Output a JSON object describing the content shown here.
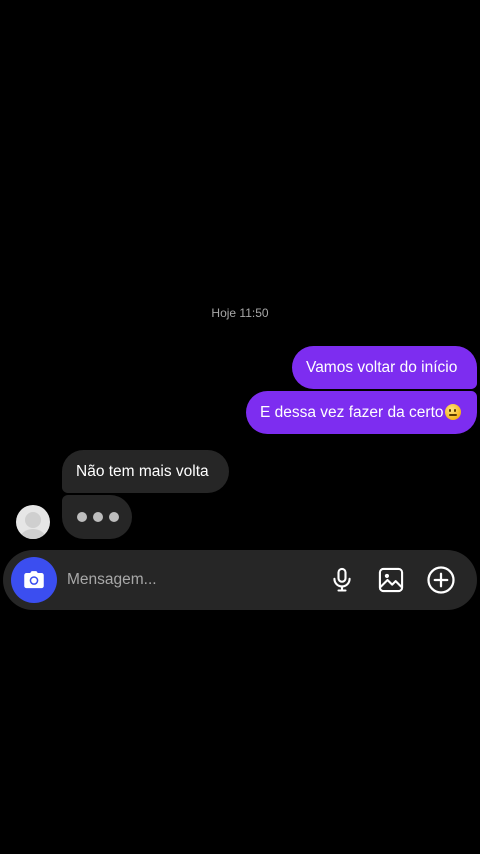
{
  "chat": {
    "timestamp": "Hoje 11:50",
    "messages": [
      {
        "direction": "outgoing",
        "text": "Vamos voltar do início"
      },
      {
        "direction": "outgoing",
        "text": "E dessa vez fazer da certo",
        "emoji": "slightly-smiling-face"
      },
      {
        "direction": "incoming",
        "text": "Não tem mais volta"
      }
    ],
    "typing_indicator": "•••"
  },
  "composer": {
    "placeholder": "Mensagem...",
    "icons": [
      "camera-icon",
      "microphone-icon",
      "gallery-icon",
      "plus-circle-icon"
    ]
  },
  "colors": {
    "background": "#000000",
    "outgoing_bubble": "#7d2df0",
    "incoming_bubble": "#262626",
    "composer_bg": "#262626",
    "camera_button": "#3b4ef0",
    "timestamp_text": "#a8a8a8"
  }
}
